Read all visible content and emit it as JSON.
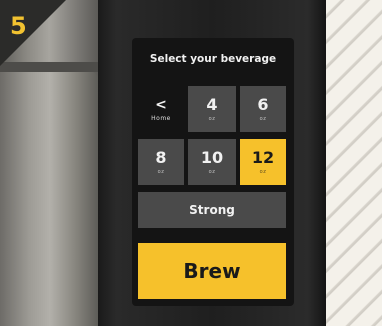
{
  "corner_number": "5",
  "title": "Select your beverage",
  "home_button": {
    "icon": "chevron-left-icon",
    "glyph": "<",
    "label": "Home"
  },
  "sizes": [
    {
      "value": "4",
      "unit": "oz",
      "selected": false
    },
    {
      "value": "6",
      "unit": "oz",
      "selected": false
    },
    {
      "value": "8",
      "unit": "oz",
      "selected": false
    },
    {
      "value": "10",
      "unit": "oz",
      "selected": false
    },
    {
      "value": "12",
      "unit": "oz",
      "selected": true
    }
  ],
  "strength_label": "Strong",
  "brew_label": "Brew",
  "colors": {
    "accent": "#f6c12b",
    "key": "#4a4a4a",
    "screen": "#141414"
  }
}
